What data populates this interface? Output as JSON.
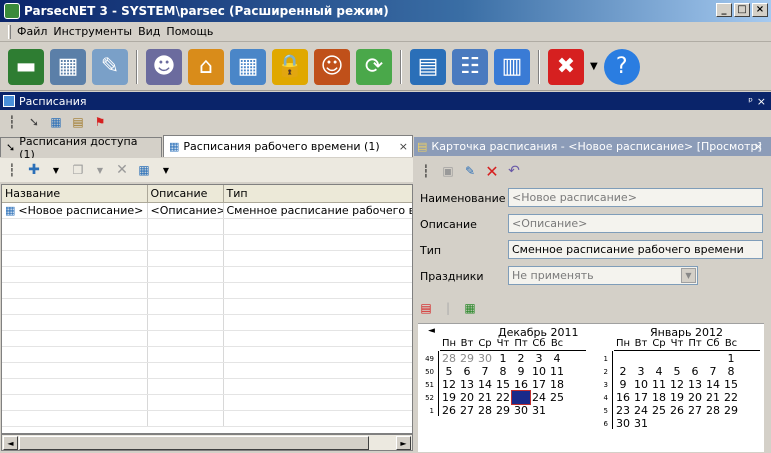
{
  "window": {
    "title": "ParsecNET 3 - SYSTEM\\parsec (Расширенный режим)",
    "min": "_",
    "max": "□",
    "close": "×"
  },
  "menu": [
    "Файл",
    "Инструменты",
    "Вид",
    "Помощь"
  ],
  "toolbar_icons": [
    "network-card-icon",
    "chip-icon",
    "document-edit-icon",
    "user-icon",
    "home-icon",
    "calendar-grid-icon",
    "lock-icon",
    "users-icon",
    "sync-icon",
    "id-card-icon",
    "org-chart-icon",
    "calendar-icon",
    "close-red-icon",
    "help-icon"
  ],
  "panel": {
    "title": "Расписания",
    "pin": "ᵖ",
    "close": "×"
  },
  "tabs": {
    "access": "Расписания доступа (1)",
    "work": "Расписания рабочего времени (1)",
    "close": "×"
  },
  "grid": {
    "columns": [
      "Название",
      "Описание",
      "Тип"
    ],
    "rows": [
      [
        "<Новое расписание>",
        "<Описание>",
        "Сменное расписание рабочего вре"
      ]
    ]
  },
  "card": {
    "title": "Карточка расписания - <Новое расписание> [Просмотр]",
    "close": "×",
    "fields": {
      "name_label": "Наименование",
      "name_value": "<Новое расписание>",
      "desc_label": "Описание",
      "desc_value": "<Описание>",
      "type_label": "Тип",
      "type_value": "Сменное расписание рабочего времени",
      "holidays_label": "Праздники",
      "holidays_value": "Не применять"
    }
  },
  "calendar": {
    "prev": "◄",
    "month1": {
      "title": "Декабрь 2011",
      "dow": [
        "Пн",
        "Вт",
        "Ср",
        "Чт",
        "Пт",
        "Сб",
        "Вс"
      ],
      "weeks": [
        "49",
        "50",
        "51",
        "52",
        "1"
      ],
      "rows": [
        [
          "28",
          "29",
          "30",
          "1",
          "2",
          "3",
          "4"
        ],
        [
          "5",
          "6",
          "7",
          "8",
          "9",
          "10",
          "11"
        ],
        [
          "12",
          "13",
          "14",
          "15",
          "16",
          "17",
          "18"
        ],
        [
          "19",
          "20",
          "21",
          "22",
          "23",
          "24",
          "25"
        ],
        [
          "26",
          "27",
          "28",
          "29",
          "30",
          "31",
          ""
        ]
      ],
      "selected": "23"
    },
    "month2": {
      "title": "Январь 2012",
      "dow": [
        "Пн",
        "Вт",
        "Ср",
        "Чт",
        "Пт",
        "Сб",
        "Вс"
      ],
      "weeks": [
        "1",
        "2",
        "3",
        "4",
        "5",
        "6"
      ],
      "rows": [
        [
          "",
          "",
          "",
          "",
          "",
          "",
          "1"
        ],
        [
          "2",
          "3",
          "4",
          "5",
          "6",
          "7",
          "8"
        ],
        [
          "9",
          "10",
          "11",
          "12",
          "13",
          "14",
          "15"
        ],
        [
          "16",
          "17",
          "18",
          "19",
          "20",
          "21",
          "22"
        ],
        [
          "23",
          "24",
          "25",
          "26",
          "27",
          "28",
          "29"
        ],
        [
          "30",
          "31",
          "",
          "",
          "",
          "",
          ""
        ]
      ]
    }
  }
}
